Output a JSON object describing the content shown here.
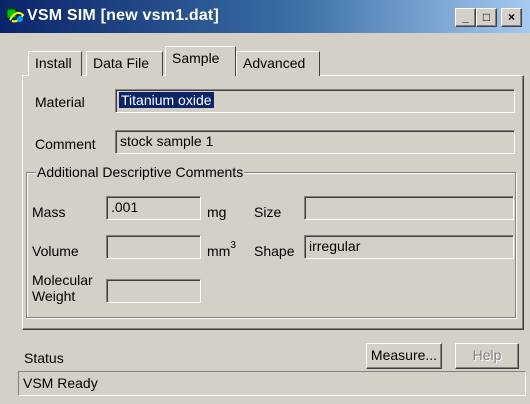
{
  "window": {
    "title": "VSM SIM [new vsm1.dat]",
    "minimize_glyph": "_",
    "maximize_glyph": "□",
    "close_glyph": "×"
  },
  "tabs": [
    {
      "label": "Install"
    },
    {
      "label": "Data File"
    },
    {
      "label": "Sample",
      "selected": true
    },
    {
      "label": "Advanced"
    }
  ],
  "sample": {
    "material_label": "Material",
    "material_value": "Titanium oxide",
    "comment_label": "Comment",
    "comment_value": "stock sample 1",
    "group_title": "Additional Descriptive Comments",
    "mass_label": "Mass",
    "mass_value": ".001",
    "mass_unit": "mg",
    "size_label": "Size",
    "size_value": "",
    "volume_label": "Volume",
    "volume_value": "",
    "volume_unit_base": "mm",
    "volume_unit_exp": "3",
    "shape_label": "Shape",
    "shape_value": "irregular",
    "molecular_label_line1": "Molecular",
    "molecular_label_line2": "Weight",
    "molecular_value": ""
  },
  "status": {
    "label": "Status",
    "measure_button": "Measure...",
    "help_button": "Help",
    "message": "VSM Ready"
  },
  "colors": {
    "titlebar_start": "#0a246a",
    "titlebar_end": "#a6caf0",
    "face": "#d4d0c8",
    "selection": "#0a246a"
  }
}
